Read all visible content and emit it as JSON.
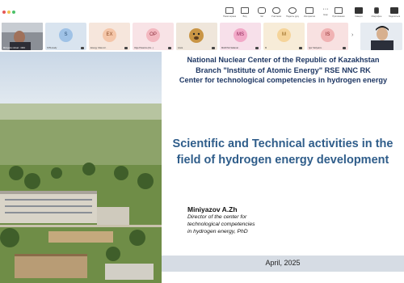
{
  "toolbar": {
    "buttons": [
      {
        "icon": "display-icon",
        "label": "Показ экрана"
      },
      {
        "icon": "window-icon",
        "label": "Вид"
      },
      {
        "icon": "chat-icon",
        "label": "Чат"
      },
      {
        "icon": "participants-icon",
        "label": "Участники"
      },
      {
        "icon": "reaction-icon",
        "label": "Поднять руку"
      },
      {
        "icon": "whiteboard-icon",
        "label": "Интерактив"
      },
      {
        "icon": "more-icon",
        "label": "Ещё"
      },
      {
        "icon": "apps-icon",
        "label": "Приложения"
      },
      {
        "icon": "camera-icon",
        "label": "Камера"
      },
      {
        "icon": "microphone-icon",
        "label": "Микрофон"
      },
      {
        "icon": "share-icon",
        "label": "Поделиться"
      }
    ],
    "dot_colors": [
      "#e45858",
      "#f2c14e",
      "#4cc26a"
    ]
  },
  "participants": [
    {
      "initials": "",
      "name": "Miniyazov Almaz  · NNC",
      "color": "#6b5a4e",
      "photo": true
    },
    {
      "initials": "S",
      "name": "SITA study",
      "color": "#5b9bd5"
    },
    {
      "initials": "EX",
      "name": "Energy Cities kz  ·",
      "color": "#e88c5d"
    },
    {
      "initials": "OP",
      "name": "Olga Potanina (Ko...)",
      "color": "#e8727c"
    },
    {
      "initials": "",
      "name": "Алия  ·",
      "color": "#c28a3b",
      "photo": true
    },
    {
      "initials": "MS",
      "name": "MAZOVA Saltanat  ·",
      "color": "#d94e8f"
    },
    {
      "initials": "M",
      "name": "M",
      "color": "#e6a93a"
    },
    {
      "initials": "IS",
      "name": "Igor Stolyarov  ·",
      "color": "#d8585e"
    },
    {
      "initials": "",
      "name": "",
      "color": "#8aa6c8",
      "photo": true
    }
  ],
  "slide": {
    "header_lines": [
      "National Nuclear Center of the Republic of Kazakhstan",
      "Branch \"Institute of Atomic Energy\" RSE NNC RK",
      "Center for technological competencies in hydrogen energy"
    ],
    "title": "Scientific and Technical activities in the field of hydrogen energy development",
    "author_name": "Miniyazov A.Zh",
    "author_role_lines": [
      "Director of the center for",
      "technological competencies",
      "in hydrogen energy, PhD"
    ],
    "date": "April, 2025",
    "colors": {
      "header": "#1f3864",
      "title": "#2f5d8a",
      "footer": "#d6dce4"
    }
  }
}
